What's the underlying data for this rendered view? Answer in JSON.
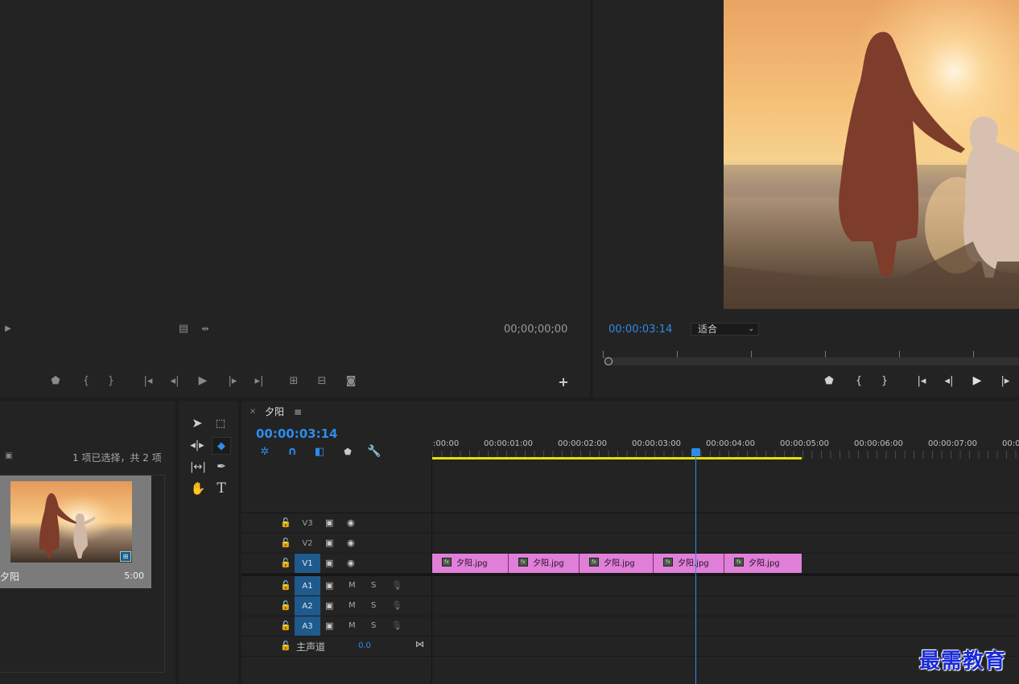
{
  "source_monitor": {
    "timecode": "00;00;00;00"
  },
  "program_monitor": {
    "timecode": "00:00:03:14",
    "zoom_label": "适合"
  },
  "project": {
    "selection_status": "1 项已选择，共 2 项",
    "item_name": "夕阳",
    "item_duration": "5:00"
  },
  "sequence": {
    "tab_title": "夕阳",
    "timecode": "00:00:03:14",
    "ruler": [
      ":00:00",
      "00:00:01:00",
      "00:00:02:00",
      "00:00:03:00",
      "00:00:04:00",
      "00:00:05:00",
      "00:00:06:00",
      "00:00:07:00",
      "00:0"
    ],
    "tracks": {
      "v3": "V3",
      "v2": "V2",
      "v1": "V1",
      "a1": "A1",
      "a2": "A2",
      "a3": "A3",
      "mute": "M",
      "solo": "S",
      "master": "主声道",
      "master_vol": "0.0"
    },
    "clips": [
      {
        "name": "夕阳.jpg"
      },
      {
        "name": "夕阳.jpg"
      },
      {
        "name": "夕阳.jpg"
      },
      {
        "name": "夕阳.jpg"
      },
      {
        "name": "夕阳.jpg"
      }
    ]
  },
  "watermark": "最需教育",
  "colors": {
    "accent_blue": "#2d8ceb",
    "clip_pink": "#e07fd8",
    "track_blue": "#1f5a8c",
    "work_area": "#e8e000"
  }
}
